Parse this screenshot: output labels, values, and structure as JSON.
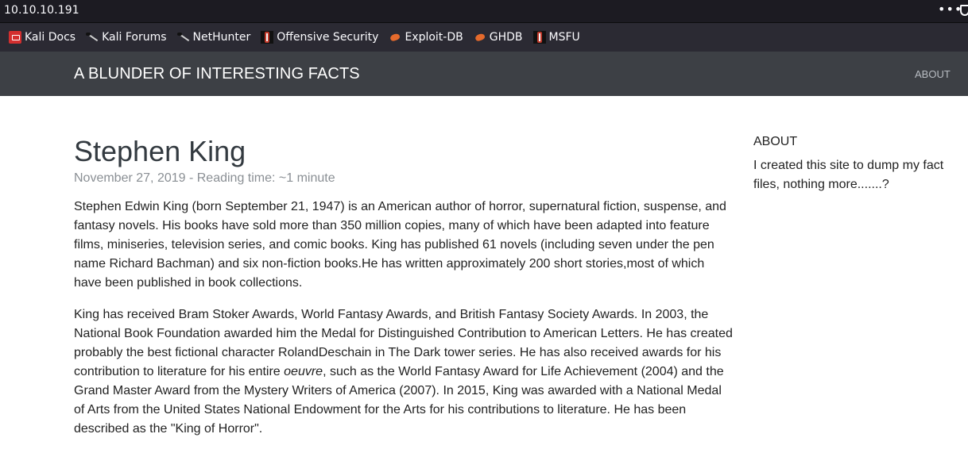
{
  "browser": {
    "url": "10.10.10.191",
    "menu_icon": "ellipsis-icon",
    "shield_icon": "shield-icon",
    "bookmarks": [
      {
        "label": "Kali Docs",
        "icon": "kali-docs-icon"
      },
      {
        "label": "Kali Forums",
        "icon": "kali-dragon-icon"
      },
      {
        "label": "NetHunter",
        "icon": "kali-dragon-icon"
      },
      {
        "label": "Offensive Security",
        "icon": "offsec-icon"
      },
      {
        "label": "Exploit-DB",
        "icon": "exploit-db-icon"
      },
      {
        "label": "GHDB",
        "icon": "exploit-db-icon"
      },
      {
        "label": "MSFU",
        "icon": "offsec-icon"
      }
    ]
  },
  "site": {
    "brand": "A BLUNDER OF INTERESTING FACTS",
    "nav_about": "ABOUT"
  },
  "post": {
    "title": "Stephen King",
    "meta": "November 27, 2019 - Reading time: ~1 minute",
    "paragraph1": "Stephen Edwin King (born September 21, 1947) is an American author of horror, supernatural fiction, suspense, and fantasy novels. His books have sold more than 350 million copies, many of which have been adapted into feature films, miniseries, television series, and comic books. King has published 61 novels (including seven under the pen name Richard Bachman) and six non-fiction books.He has written approximately 200 short stories,most of which have been published in book collections.",
    "paragraph2_before": "King has received Bram Stoker Awards, World Fantasy Awards, and British Fantasy Society Awards. In 2003, the National Book Foundation awarded him the Medal for Distinguished Contribution to American Letters. He has created probably the best fictional character RolandDeschain in The Dark tower series. He has also received awards for his contribution to literature for his entire ",
    "paragraph2_em": "oeuvre",
    "paragraph2_after": ", such as the World Fantasy Award for Life Achievement (2004) and the Grand Master Award from the Mystery Writers of America (2007). In 2015, King was awarded with a National Medal of Arts from the United States National Endowment for the Arts for his contributions to literature. He has been described as the \"King of Horror\"."
  },
  "sidebar": {
    "heading": "ABOUT",
    "text": "I created this site to dump my fact files, nothing more.......?"
  }
}
